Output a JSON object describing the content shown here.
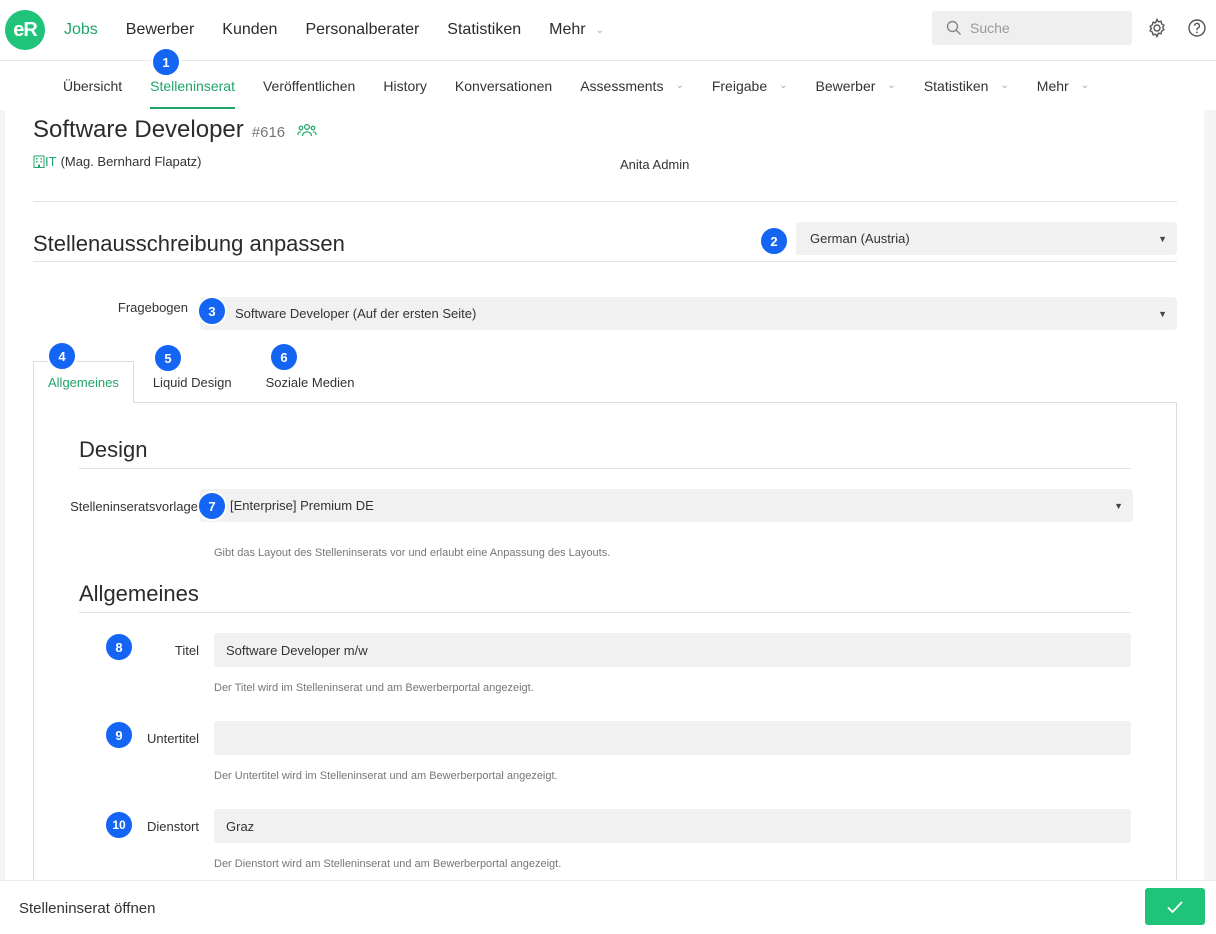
{
  "brand": {
    "logo_text": "eR",
    "accent": "#1fa56a",
    "logo_color": "#1fc47a",
    "badge_color": "#1565f5"
  },
  "mainnav": {
    "items": [
      {
        "label": "Jobs",
        "active": true
      },
      {
        "label": "Bewerber"
      },
      {
        "label": "Kunden"
      },
      {
        "label": "Personalberater"
      },
      {
        "label": "Statistiken"
      },
      {
        "label": "Mehr",
        "dropdown": true
      }
    ]
  },
  "search": {
    "placeholder": "Suche"
  },
  "subnav": {
    "items": [
      {
        "label": "Übersicht"
      },
      {
        "label": "Stelleninserat",
        "active": true
      },
      {
        "label": "Veröffentlichen"
      },
      {
        "label": "History"
      },
      {
        "label": "Konversationen"
      },
      {
        "label": "Assessments",
        "dropdown": true
      },
      {
        "label": "Freigabe",
        "dropdown": true
      },
      {
        "label": "Bewerber",
        "dropdown": true
      },
      {
        "label": "Statistiken",
        "dropdown": true
      },
      {
        "label": "Mehr",
        "dropdown": true
      }
    ]
  },
  "job": {
    "title": "Software Developer",
    "number": "#616",
    "department": "IT",
    "department_contact": "(Mag. Bernhard Flapatz)",
    "owner": "Anita Admin"
  },
  "customize": {
    "title": "Stellenausschreibung anpassen",
    "language": "German (Austria)",
    "questionnaire_label": "Fragebogen",
    "questionnaire_value": "Software Developer (Auf der ersten Seite)"
  },
  "tabs": [
    {
      "label": "Allgemeines",
      "active": true
    },
    {
      "label": "Liquid Design"
    },
    {
      "label": "Soziale Medien"
    }
  ],
  "design": {
    "title": "Design",
    "template_label": "Stelleninseratsvorlage",
    "template_value": "[Enterprise] Premium DE",
    "template_help": "Gibt das Layout des Stelleninserats vor und erlaubt eine Anpassung des Layouts."
  },
  "general": {
    "title": "Allgemeines",
    "title_label": "Titel",
    "title_value": "Software Developer m/w",
    "title_help": "Der Titel wird im Stelleninserat und am Bewerberportal angezeigt.",
    "subtitle_label": "Untertitel",
    "subtitle_value": "",
    "subtitle_help": "Der Untertitel wird im Stelleninserat und am Bewerberportal angezeigt.",
    "location_label": "Dienstort",
    "location_value": "Graz",
    "location_help": "Der Dienstort wird am Stelleninserat und am Bewerberportal angezeigt."
  },
  "badges": [
    "1",
    "2",
    "3",
    "4",
    "5",
    "6",
    "7",
    "8",
    "9",
    "10"
  ],
  "footer": {
    "open_label": "Stelleninserat öffnen"
  }
}
